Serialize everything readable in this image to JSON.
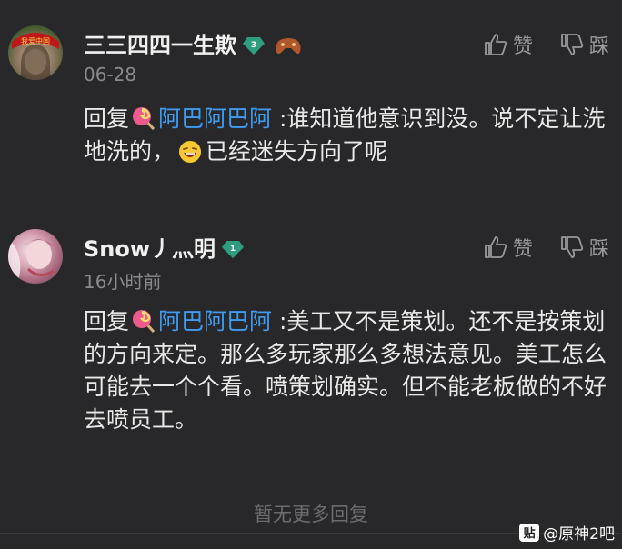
{
  "comments": [
    {
      "username": "三三四四一生欺",
      "level": "3",
      "time": "06-28",
      "like_label": "赞",
      "dislike_label": "踩",
      "reply_prefix": "回复",
      "mention": "阿巴阿巴阿",
      "text_before_emoji": ":谁知道他意识到没。说不定让洗地洗的，",
      "text_after_emoji": "已经迷失方向了呢",
      "avatar_badge_text": "我爱中国"
    },
    {
      "username": "Snow丿灬明",
      "level": "1",
      "time": "16小时前",
      "like_label": "赞",
      "dislike_label": "踩",
      "reply_prefix": "回复",
      "mention": "阿巴阿巴阿",
      "text": ":美工又不是策划。还不是按策划的方向来定。那么多玩家那么多想法意见。美工怎么可能去一个个看。喷策划确实。但不能老板做的不好去喷员工。"
    }
  ],
  "footer": {
    "no_more": "暂无更多回复"
  },
  "watermark": {
    "logo": "贴",
    "text": "@原神2吧"
  },
  "colors": {
    "background": "#28282a",
    "mention": "#3e9cf3",
    "level_badge": "#2f9e80"
  }
}
